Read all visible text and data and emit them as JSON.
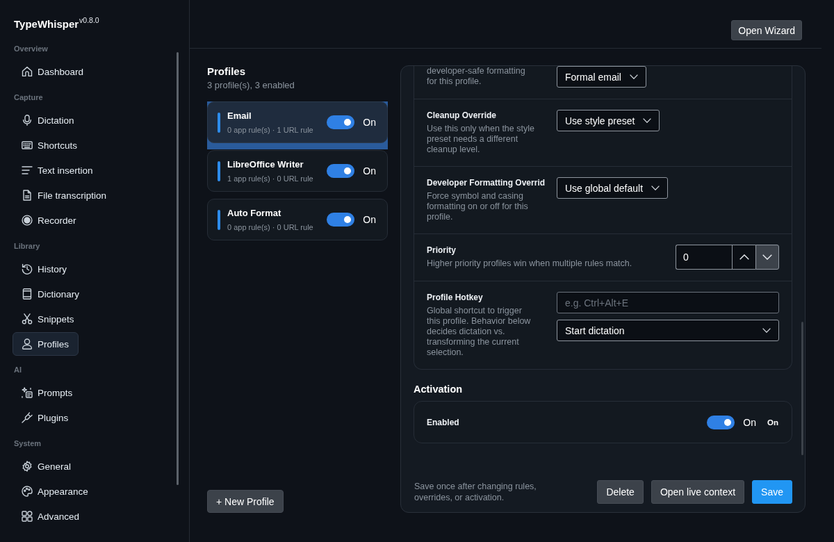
{
  "app": {
    "name": "TypeWhisper",
    "version": "v0.8.0"
  },
  "sidebar": {
    "sections": [
      {
        "title": "Overview",
        "items": [
          {
            "label": "Dashboard",
            "selected": false
          }
        ]
      },
      {
        "title": "Capture",
        "items": [
          {
            "label": "Dictation",
            "selected": false
          },
          {
            "label": "Shortcuts",
            "selected": false
          },
          {
            "label": "Text insertion",
            "selected": false
          },
          {
            "label": "File transcription",
            "selected": false
          },
          {
            "label": "Recorder",
            "selected": false
          }
        ]
      },
      {
        "title": "Library",
        "items": [
          {
            "label": "History",
            "selected": false
          },
          {
            "label": "Dictionary",
            "selected": false
          },
          {
            "label": "Snippets",
            "selected": false
          },
          {
            "label": "Profiles",
            "selected": true
          }
        ]
      },
      {
        "title": "AI",
        "items": [
          {
            "label": "Prompts",
            "selected": false
          },
          {
            "label": "Plugins",
            "selected": false
          }
        ]
      },
      {
        "title": "System",
        "items": [
          {
            "label": "General",
            "selected": false
          },
          {
            "label": "Appearance",
            "selected": false
          },
          {
            "label": "Advanced",
            "selected": false
          }
        ]
      }
    ]
  },
  "header": {
    "wizard_button": "Open Wizard"
  },
  "profiles": {
    "title": "Profiles",
    "summary": "3 profile(s), 3 enabled",
    "items": [
      {
        "name": "Email",
        "rules": "0 app rule(s) · 1 URL rule",
        "on": true,
        "state_label": "On",
        "selected": true
      },
      {
        "name": "LibreOffice Writer",
        "rules": "1 app rule(s) · 0 URL rule",
        "on": true,
        "state_label": "On",
        "selected": false
      },
      {
        "name": "Auto Format",
        "rules": "0 app rule(s) · 0 URL rule",
        "on": true,
        "state_label": "On",
        "selected": false
      }
    ],
    "new_button": "+ New Profile"
  },
  "editor": {
    "overrides": [
      {
        "kind": "select",
        "description": "developer-safe formatting for this profile.",
        "value": "Formal email"
      },
      {
        "kind": "select",
        "label": "Cleanup Override",
        "description": "Use this only when the style preset needs a different cleanup level.",
        "value": "Use style preset"
      },
      {
        "kind": "select",
        "label": "Developer Formatting Overrid",
        "description": "Force symbol and casing formatting on or off for this profile.",
        "value": "Use global default"
      },
      {
        "kind": "number",
        "label": "Priority",
        "description": "Higher priority profiles win when multiple rules match.",
        "value": "0"
      },
      {
        "kind": "hotkey",
        "label": "Profile Hotkey",
        "description": "Global shortcut to trigger this profile. Behavior below decides dictation vs. transforming the current selection.",
        "placeholder": "e.g. Ctrl+Alt+E",
        "value": "Start dictation"
      }
    ],
    "activation": {
      "title": "Activation",
      "label": "Enabled",
      "on": true,
      "state_label": "On",
      "status": "On"
    },
    "footer": {
      "note": "Save once after changing rules, overrides, or activation.",
      "buttons": [
        {
          "label": "Delete",
          "kind": "secondary"
        },
        {
          "label": "Open live context",
          "kind": "secondary"
        },
        {
          "label": "Save",
          "kind": "primary"
        }
      ]
    }
  }
}
